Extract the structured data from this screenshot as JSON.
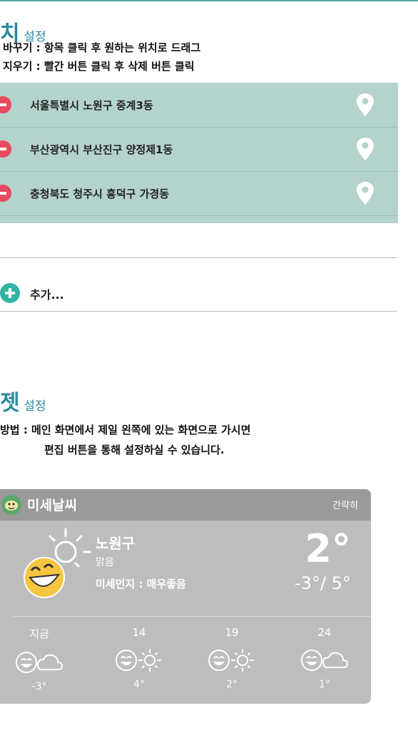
{
  "location_section": {
    "title_big": "치",
    "title_small": "설정",
    "help_line1": "바꾸기 : 항목 클릭 후 원하는 위치로 드래그",
    "help_line2": "지우기 : 빨간 버튼 클릭 후 삭제 버튼 클릭",
    "locations": [
      {
        "name": "서울특별시 노원구 중계3동"
      },
      {
        "name": "부산광역시 부산진구 양정제1동"
      },
      {
        "name": "충청북도 청주시 흥덕구 가경동"
      }
    ],
    "add_label": "추가..."
  },
  "widget_section": {
    "title_big": "젯",
    "title_small": "설정",
    "help_line1": "방법 : 메인 화면에서 제일 왼쪽에 있는 화면으로 가시면",
    "help_line2": "편집 버튼을 통해 설정하실 수 있습니다."
  },
  "widget": {
    "app_name": "미세날씨",
    "mode_label": "간략히",
    "city": "노원구",
    "condition": "맑음",
    "dust": "미세먼지 : 매우좋음",
    "temp": "2°",
    "range": "-3°/ 5°",
    "forecast": [
      {
        "time": "지금",
        "temp": "-3°",
        "sky": "cloud"
      },
      {
        "time": "14",
        "temp": "4°",
        "sky": "sun"
      },
      {
        "time": "19",
        "temp": "2°",
        "sky": "sun"
      },
      {
        "time": "24",
        "temp": "1°",
        "sky": "cloud"
      }
    ]
  },
  "colors": {
    "accent": "#2a8a9c",
    "panel": "#b5d3cd",
    "remove": "#e84a5f",
    "add": "#2fb5a2"
  }
}
